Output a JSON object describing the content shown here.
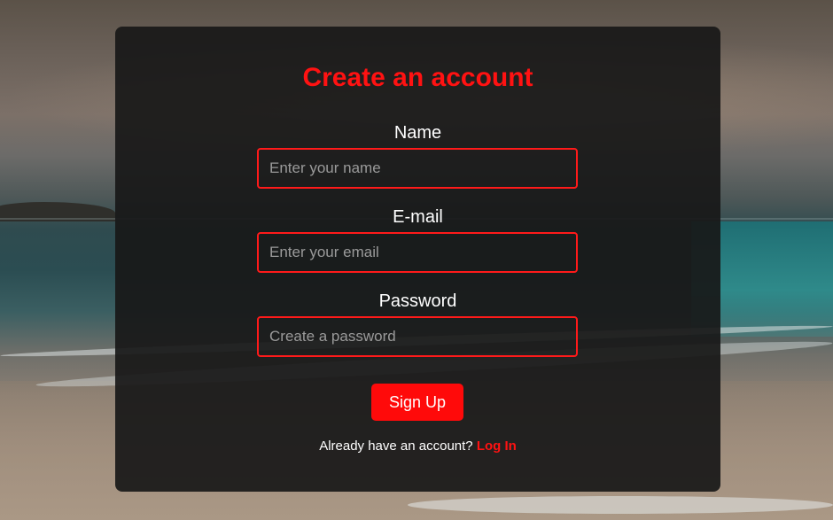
{
  "theme": {
    "accent": "#ff1212",
    "card_background": "#181818",
    "text": "#ffffff",
    "placeholder": "#9a9a9a"
  },
  "form": {
    "title": "Create an account",
    "fields": [
      {
        "label": "Name",
        "placeholder": "Enter your name",
        "value": ""
      },
      {
        "label": "E-mail",
        "placeholder": "Enter your email",
        "value": ""
      },
      {
        "label": "Password",
        "placeholder": "Create a password",
        "value": ""
      }
    ],
    "submit_label": "Sign Up",
    "footer_prompt": "Already have an account?",
    "login_link": "Log In"
  }
}
